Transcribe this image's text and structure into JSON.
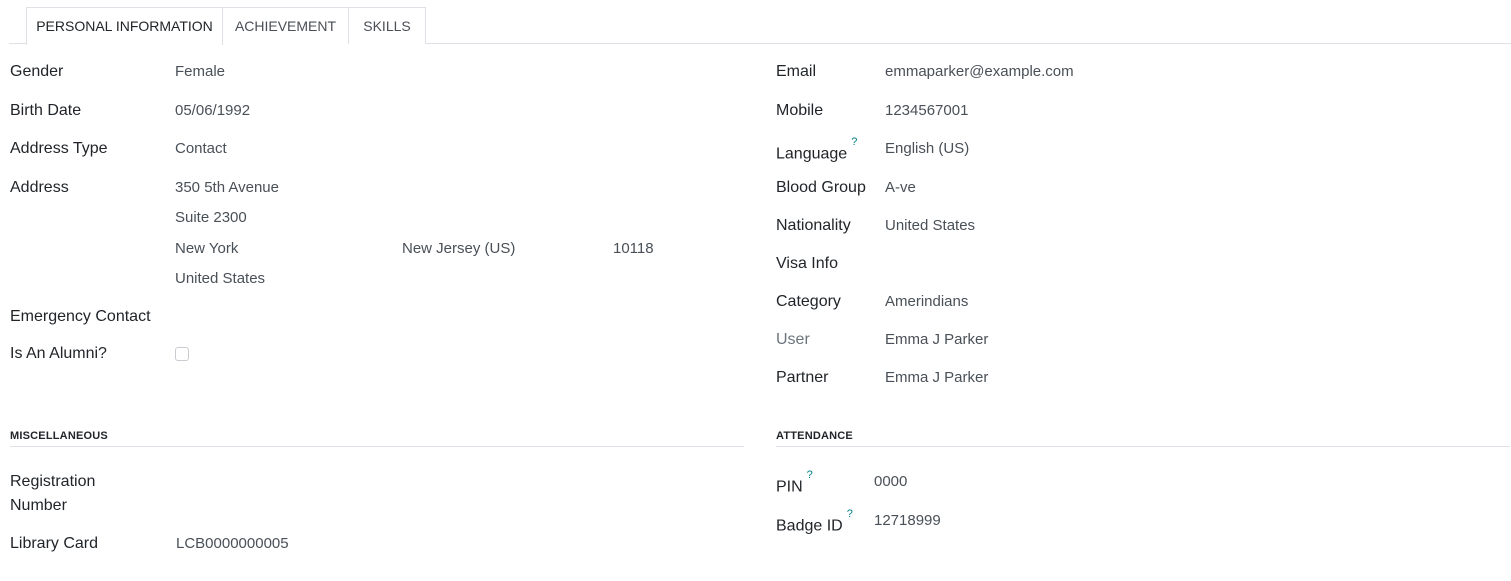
{
  "tabs": [
    {
      "label": "PERSONAL INFORMATION",
      "active": true
    },
    {
      "label": "ACHIEVEMENT",
      "active": false
    },
    {
      "label": "SKILLS",
      "active": false
    }
  ],
  "left": {
    "gender": {
      "label": "Gender",
      "value": "Female"
    },
    "birth_date": {
      "label": "Birth Date",
      "value": "05/06/1992"
    },
    "address_type": {
      "label": "Address Type",
      "value": "Contact"
    },
    "address": {
      "label": "Address",
      "street": "350 5th Avenue",
      "street2": "Suite 2300",
      "city": "New York",
      "state": "New Jersey (US)",
      "zip": "10118",
      "country": "United States"
    },
    "emergency_contact": {
      "label": "Emergency Contact",
      "value": ""
    },
    "is_alumni": {
      "label": "Is An Alumni?",
      "checked": false
    }
  },
  "right": {
    "email": {
      "label": "Email",
      "value": "emmaparker@example.com"
    },
    "mobile": {
      "label": "Mobile",
      "value": "1234567001"
    },
    "language": {
      "label": "Language",
      "help": "?",
      "value": "English (US)"
    },
    "blood_group": {
      "label": "Blood Group",
      "value": "A-ve"
    },
    "nationality": {
      "label": "Nationality",
      "value": "United States"
    },
    "visa_info": {
      "label": "Visa Info",
      "value": ""
    },
    "category": {
      "label": "Category",
      "value": "Amerindians"
    },
    "user": {
      "label": "User",
      "value": "Emma J Parker"
    },
    "partner": {
      "label": "Partner",
      "value": "Emma J Parker"
    }
  },
  "miscellaneous": {
    "title": "MISCELLANEOUS",
    "registration_number": {
      "label_line1": "Registration",
      "label_line2": "Number",
      "value": ""
    },
    "library_card": {
      "label": "Library Card",
      "value": "LCB0000000005"
    }
  },
  "attendance": {
    "title": "ATTENDANCE",
    "pin": {
      "label": "PIN",
      "help": "?",
      "value": "0000"
    },
    "badge_id": {
      "label": "Badge ID",
      "help": "?",
      "value": "12718999"
    }
  },
  "colors": {
    "accent": "#017e84",
    "border": "#dee2e6",
    "text": "#212529",
    "muted": "#6c757d"
  }
}
